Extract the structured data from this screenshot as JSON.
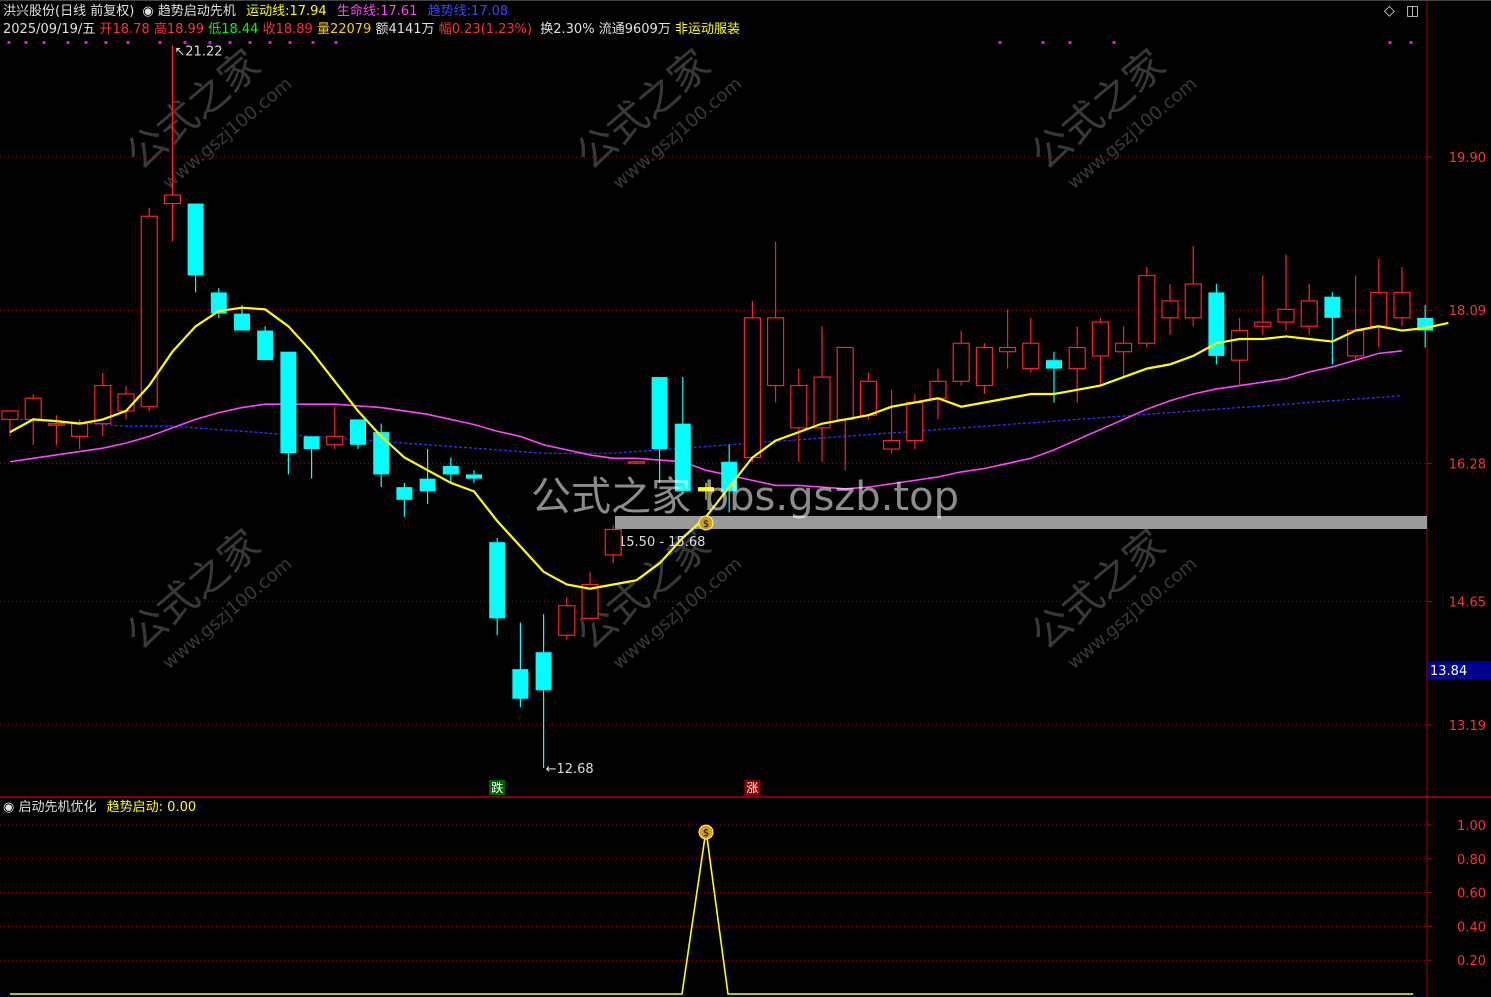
{
  "header": {
    "stock": "洪兴股份(日线 前复权)",
    "indicator": "趋势启动先机",
    "line1_label": "运动线:",
    "line1_val": "17.94",
    "line2_label": "生命线:",
    "line2_val": "17.61",
    "line3_label": "趋势线:",
    "line3_val": "17.08",
    "date": "2025/09/19/五",
    "open_label": "开",
    "open_val": "18.78",
    "high_label": "高",
    "high_val": "18.99",
    "low_label": "低",
    "low_val": "18.44",
    "close_label": "收",
    "close_val": "18.89",
    "vol_label": "量",
    "vol_val": "22079",
    "amt": "额4141万",
    "chg_label": "幅",
    "chg_val": "0.23(1.23%)",
    "turnover": "换2.30%",
    "float": "流通9609万",
    "sector": "非运动服装"
  },
  "sub_header": {
    "name": "启动先机优化",
    "label": "趋势启动:",
    "value": "0.00"
  },
  "watermark": "公式之家 bbs.gszb.top",
  "bg_watermark": "公式之家",
  "bg_watermark_url": "www.gszj100.com",
  "colors": {
    "up": "#ff2020",
    "down": "#00ffff",
    "ma_fast": "#ffff00",
    "ma_life": "#ff44ff",
    "ma_trend": "#3030ff",
    "grid": "#b00000",
    "zone": "#9a9a9a",
    "price_tag_bg": "#000090",
    "signal": "#ffff00"
  },
  "chart_data": [
    {
      "type": "candlestick",
      "y_ticks": [
        19.9,
        18.09,
        16.28,
        14.65,
        13.19
      ],
      "ylim": [
        12.0,
        22.0
      ],
      "current_price_tag": 13.84,
      "max_label": "21.22",
      "min_label": "12.68",
      "zone_label": "15.50 - 15.68",
      "zone": [
        15.5,
        15.68
      ],
      "marker_down": "跌",
      "marker_up": "涨",
      "candles": [
        {
          "o": 16.8,
          "h": 16.9,
          "l": 16.6,
          "c": 16.9
        },
        {
          "o": 16.8,
          "h": 17.1,
          "l": 16.5,
          "c": 17.05
        },
        {
          "o": 16.75,
          "h": 16.85,
          "l": 16.5,
          "c": 16.75
        },
        {
          "o": 16.6,
          "h": 16.8,
          "l": 16.45,
          "c": 16.75
        },
        {
          "o": 16.75,
          "h": 17.35,
          "l": 16.6,
          "c": 17.2
        },
        {
          "o": 16.9,
          "h": 17.2,
          "l": 16.8,
          "c": 17.1
        },
        {
          "o": 16.95,
          "h": 19.3,
          "l": 16.9,
          "c": 19.2
        },
        {
          "o": 19.35,
          "h": 21.22,
          "l": 18.9,
          "c": 19.45
        },
        {
          "o": 19.35,
          "h": 19.35,
          "l": 18.3,
          "c": 18.5
        },
        {
          "o": 18.3,
          "h": 18.35,
          "l": 18.0,
          "c": 18.05
        },
        {
          "o": 18.05,
          "h": 18.15,
          "l": 17.85,
          "c": 17.85
        },
        {
          "o": 17.85,
          "h": 17.9,
          "l": 17.5,
          "c": 17.5
        },
        {
          "o": 17.6,
          "h": 17.6,
          "l": 16.15,
          "c": 16.4
        },
        {
          "o": 16.6,
          "h": 16.6,
          "l": 16.1,
          "c": 16.45
        },
        {
          "o": 16.5,
          "h": 16.95,
          "l": 16.45,
          "c": 16.6
        },
        {
          "o": 16.8,
          "h": 16.8,
          "l": 16.45,
          "c": 16.5
        },
        {
          "o": 16.65,
          "h": 16.75,
          "l": 16.0,
          "c": 16.15
        },
        {
          "o": 16.0,
          "h": 16.05,
          "l": 15.65,
          "c": 15.85
        },
        {
          "o": 16.1,
          "h": 16.45,
          "l": 15.8,
          "c": 15.95
        },
        {
          "o": 16.25,
          "h": 16.35,
          "l": 16.05,
          "c": 16.15
        },
        {
          "o": 16.15,
          "h": 16.2,
          "l": 16.05,
          "c": 16.1
        },
        {
          "o": 15.35,
          "h": 15.4,
          "l": 14.25,
          "c": 14.45
        },
        {
          "o": 13.85,
          "h": 14.4,
          "l": 13.4,
          "c": 13.5
        },
        {
          "o": 14.05,
          "h": 14.5,
          "l": 12.68,
          "c": 13.6
        },
        {
          "o": 14.25,
          "h": 14.7,
          "l": 14.2,
          "c": 14.6
        },
        {
          "o": 14.45,
          "h": 15.0,
          "l": 14.45,
          "c": 14.85
        },
        {
          "o": 15.2,
          "h": 15.55,
          "l": 15.1,
          "c": 15.5
        },
        {
          "o": 16.3,
          "h": 16.3,
          "l": 16.3,
          "c": 16.3
        },
        {
          "o": 17.3,
          "h": 17.3,
          "l": 16.05,
          "c": 16.45
        },
        {
          "o": 16.75,
          "h": 17.3,
          "l": 15.95,
          "c": 15.95
        },
        {
          "o": 16.0,
          "h": 16.05,
          "l": 15.85,
          "c": 15.95
        },
        {
          "o": 16.3,
          "h": 16.5,
          "l": 15.7,
          "c": 15.95
        },
        {
          "o": 16.35,
          "h": 18.2,
          "l": 16.3,
          "c": 18.0
        },
        {
          "o": 17.2,
          "h": 18.9,
          "l": 17.0,
          "c": 18.0
        },
        {
          "o": 16.7,
          "h": 17.4,
          "l": 16.3,
          "c": 17.2
        },
        {
          "o": 16.7,
          "h": 17.9,
          "l": 16.3,
          "c": 17.3
        },
        {
          "o": 16.8,
          "h": 17.5,
          "l": 16.2,
          "c": 17.65
        },
        {
          "o": 16.85,
          "h": 17.35,
          "l": 16.8,
          "c": 17.25
        },
        {
          "o": 16.45,
          "h": 17.15,
          "l": 16.4,
          "c": 16.55
        },
        {
          "o": 16.55,
          "h": 17.1,
          "l": 16.45,
          "c": 17.0
        },
        {
          "o": 17.05,
          "h": 17.4,
          "l": 16.8,
          "c": 17.25
        },
        {
          "o": 17.25,
          "h": 17.85,
          "l": 17.2,
          "c": 17.7
        },
        {
          "o": 17.2,
          "h": 17.7,
          "l": 17.1,
          "c": 17.65
        },
        {
          "o": 17.6,
          "h": 18.1,
          "l": 17.4,
          "c": 17.65
        },
        {
          "o": 17.4,
          "h": 18.0,
          "l": 17.35,
          "c": 17.7
        },
        {
          "o": 17.5,
          "h": 17.6,
          "l": 17.0,
          "c": 17.4
        },
        {
          "o": 17.4,
          "h": 17.9,
          "l": 17.0,
          "c": 17.65
        },
        {
          "o": 17.55,
          "h": 18.0,
          "l": 17.2,
          "c": 17.95
        },
        {
          "o": 17.6,
          "h": 17.9,
          "l": 17.3,
          "c": 17.7
        },
        {
          "o": 17.7,
          "h": 18.6,
          "l": 17.65,
          "c": 18.5
        },
        {
          "o": 18.0,
          "h": 18.4,
          "l": 17.8,
          "c": 18.2
        },
        {
          "o": 18.0,
          "h": 18.85,
          "l": 17.9,
          "c": 18.4
        },
        {
          "o": 18.3,
          "h": 18.4,
          "l": 17.45,
          "c": 17.55
        },
        {
          "o": 17.5,
          "h": 18.0,
          "l": 17.2,
          "c": 17.85
        },
        {
          "o": 17.9,
          "h": 18.5,
          "l": 17.8,
          "c": 17.95
        },
        {
          "o": 17.95,
          "h": 18.75,
          "l": 17.85,
          "c": 18.1
        },
        {
          "o": 17.9,
          "h": 18.4,
          "l": 17.8,
          "c": 18.2
        },
        {
          "o": 18.25,
          "h": 18.3,
          "l": 17.45,
          "c": 18.0
        },
        {
          "o": 17.55,
          "h": 18.5,
          "l": 17.5,
          "c": 17.85
        },
        {
          "o": 17.9,
          "h": 18.7,
          "l": 17.65,
          "c": 18.3
        },
        {
          "o": 18.0,
          "h": 18.6,
          "l": 17.9,
          "c": 18.3
        },
        {
          "o": 18.0,
          "h": 18.15,
          "l": 17.65,
          "c": 17.85
        }
      ],
      "ma_fast": [
        16.65,
        16.8,
        16.78,
        16.75,
        16.8,
        16.9,
        17.2,
        17.6,
        17.9,
        18.08,
        18.12,
        18.1,
        17.9,
        17.6,
        17.25,
        16.9,
        16.6,
        16.35,
        16.2,
        16.05,
        15.95,
        15.6,
        15.3,
        15.0,
        14.85,
        14.8,
        14.85,
        14.9,
        15.1,
        15.4,
        15.65,
        16.0,
        16.35,
        16.55,
        16.65,
        16.75,
        16.8,
        16.85,
        16.95,
        17.0,
        17.05,
        16.95,
        17.0,
        17.05,
        17.1,
        17.1,
        17.15,
        17.2,
        17.3,
        17.4,
        17.45,
        17.55,
        17.7,
        17.75,
        17.75,
        17.78,
        17.75,
        17.72,
        17.85,
        17.9,
        17.85,
        17.88,
        17.94
      ],
      "ma_life": [
        16.3,
        16.34,
        16.38,
        16.42,
        16.46,
        16.52,
        16.6,
        16.7,
        16.8,
        16.88,
        16.94,
        16.98,
        16.98,
        16.98,
        16.98,
        16.96,
        16.94,
        16.9,
        16.86,
        16.8,
        16.74,
        16.66,
        16.6,
        16.5,
        16.44,
        16.38,
        16.34,
        16.34,
        16.32,
        16.3,
        16.2,
        16.14,
        16.08,
        16.02,
        16.02,
        16.0,
        15.98,
        16.0,
        16.04,
        16.08,
        16.12,
        16.18,
        16.22,
        16.28,
        16.34,
        16.44,
        16.56,
        16.68,
        16.8,
        16.92,
        17.02,
        17.1,
        17.16,
        17.2,
        17.24,
        17.28,
        17.36,
        17.42,
        17.5,
        17.58,
        17.61
      ],
      "ma_trend": [
        16.8,
        16.8,
        16.78,
        16.76,
        16.74,
        16.72,
        16.72,
        16.72,
        16.7,
        16.68,
        16.66,
        16.64,
        16.62,
        16.6,
        16.58,
        16.56,
        16.54,
        16.52,
        16.5,
        16.48,
        16.46,
        16.44,
        16.42,
        16.4,
        16.4,
        16.4,
        16.4,
        16.42,
        16.44,
        16.46,
        16.48,
        16.5,
        16.52,
        16.54,
        16.56,
        16.58,
        16.6,
        16.62,
        16.64,
        16.66,
        16.68,
        16.7,
        16.72,
        16.74,
        16.76,
        16.78,
        16.8,
        16.82,
        16.84,
        16.86,
        16.88,
        16.9,
        16.92,
        16.94,
        16.96,
        16.98,
        17.0,
        17.02,
        17.04,
        17.06,
        17.08
      ]
    },
    {
      "type": "line",
      "y_ticks": [
        1.0,
        0.8,
        0.6,
        0.4,
        0.2
      ],
      "ylim": [
        0,
        1.1
      ],
      "signal": [
        0,
        0,
        0,
        0,
        0,
        0,
        0,
        0,
        0,
        0,
        0,
        0,
        0,
        0,
        0,
        0,
        0,
        0,
        0,
        0,
        0,
        0,
        0,
        0,
        0,
        0,
        0,
        0,
        0,
        0,
        1,
        0,
        0,
        0,
        0,
        0,
        0,
        0,
        0,
        0,
        0,
        0,
        0,
        0,
        0,
        0,
        0,
        0,
        0,
        0,
        0,
        0,
        0,
        0,
        0,
        0,
        0,
        0,
        0,
        0,
        0,
        0,
        0
      ]
    }
  ]
}
